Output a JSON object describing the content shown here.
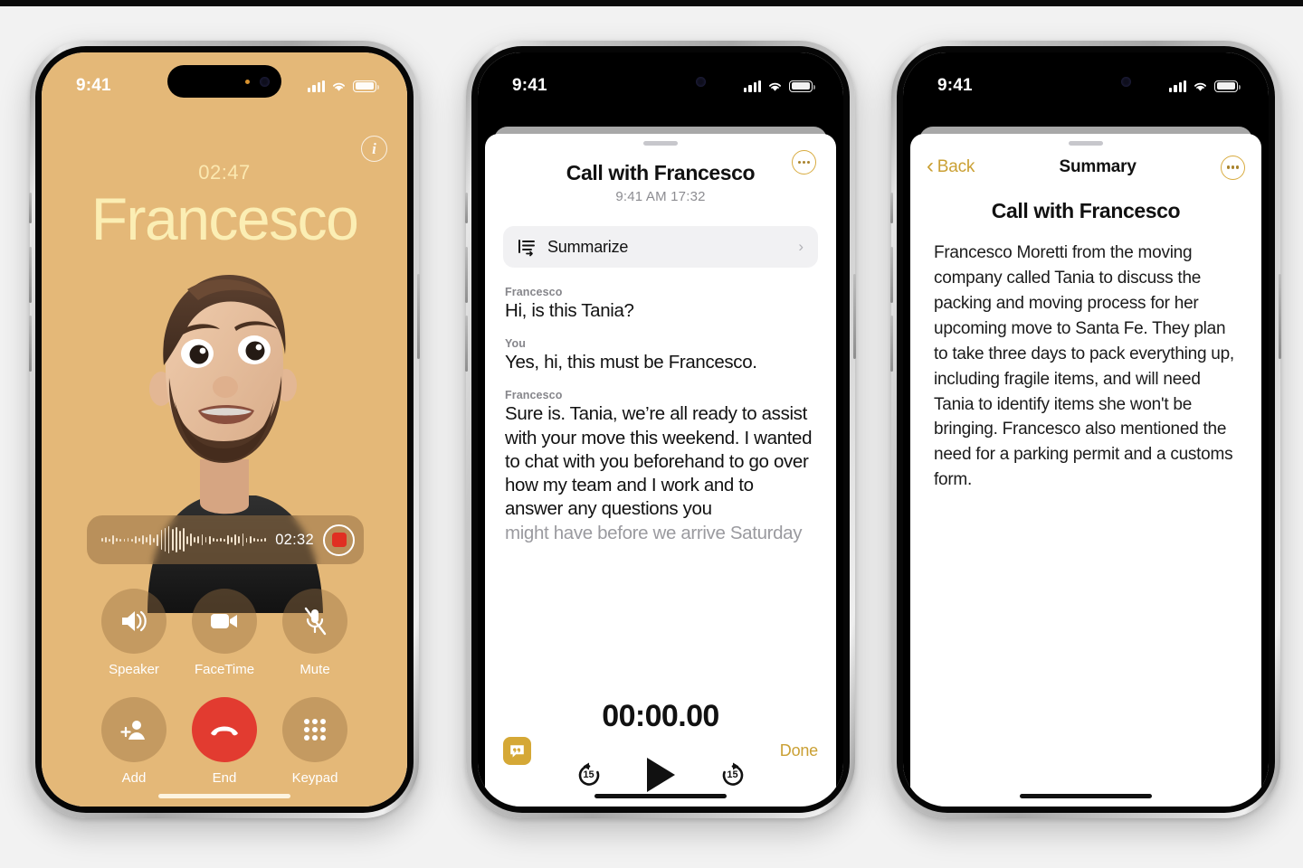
{
  "page": {
    "background": "#f2f2f2",
    "accent_gold": "#caa034",
    "call_bg": "#e4b878"
  },
  "phone1": {
    "name": "call-screen",
    "status": {
      "time": "9:41",
      "signal": "signal-bars-icon",
      "wifi": "wifi-icon",
      "battery": "battery-full-icon"
    },
    "info_button": "i",
    "timer": "02:47",
    "caller_name": "Francesco",
    "avatar": "memoji-avatar",
    "recording": {
      "time": "02:32",
      "button": "stop-record-button",
      "waveform": "audio-waveform"
    },
    "controls": [
      {
        "label": "Speaker",
        "icon": "speaker-icon",
        "style": "normal"
      },
      {
        "label": "FaceTime",
        "icon": "video-icon",
        "style": "normal"
      },
      {
        "label": "Mute",
        "icon": "mic-off-icon",
        "style": "normal"
      },
      {
        "label": "Add",
        "icon": "add-person-icon",
        "style": "normal"
      },
      {
        "label": "End",
        "icon": "end-call-icon",
        "style": "end"
      },
      {
        "label": "Keypad",
        "icon": "keypad-icon",
        "style": "normal"
      }
    ]
  },
  "phone2": {
    "name": "call-transcript-sheet",
    "status": {
      "time": "9:41"
    },
    "title": "Call with Francesco",
    "subtitle": "9:41 AM  17:32",
    "more_button": "ellipsis-button",
    "summarize": {
      "label": "Summarize",
      "icon": "summarize-icon",
      "chevron": "›"
    },
    "transcript": [
      {
        "speaker": "Francesco",
        "text": "Hi, is this Tania?",
        "faded": false
      },
      {
        "speaker": "You",
        "text": "Yes, hi, this must be Francesco.",
        "faded": false
      },
      {
        "speaker": "Francesco",
        "text": "Sure is. Tania, we’re all ready to assist with your move this weekend. I wanted to chat with you beforehand to go over how my team and I work and to answer any questions you",
        "faded": false
      },
      {
        "speaker": "",
        "text": "might have before we arrive Saturday",
        "faded": true
      }
    ],
    "player": {
      "elapsed": "00:00.00",
      "skip_back": "15",
      "skip_forward": "15",
      "play_button": "play-button"
    },
    "bottom": {
      "quote_icon": "transcript-quote-icon",
      "done_label": "Done"
    }
  },
  "phone3": {
    "name": "call-summary-sheet",
    "status": {
      "time": "9:41"
    },
    "back_label": "Back",
    "nav_title": "Summary",
    "more_button": "ellipsis-button",
    "heading": "Call with Francesco",
    "body": "Francesco Moretti from the moving company called Tania to discuss the packing and moving process for her upcoming move to Santa Fe. They plan to take three days to pack everything up, including fragile items, and will need Tania to identify items she won't be bringing. Francesco also mentioned the need for a parking permit and a customs form."
  }
}
